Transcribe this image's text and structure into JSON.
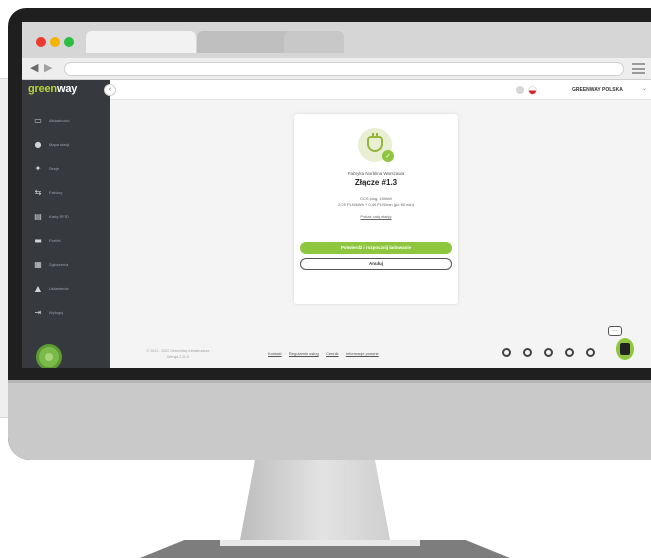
{
  "app": {
    "logo_green": "green",
    "logo_white": "way"
  },
  "browser": {
    "back_icon": "triangle-left-icon",
    "forward_icon": "triangle-right-icon"
  },
  "header": {
    "account_name": "GREENWAY POLSKA",
    "account_caret": "⌄"
  },
  "sidebar": {
    "items": [
      {
        "icon": "chat-icon",
        "glyph": "▭",
        "label": "Aktualności"
      },
      {
        "icon": "map-pin-icon",
        "glyph": "●",
        "label": "Mapa stacji"
      },
      {
        "icon": "lightning-icon",
        "glyph": "✦",
        "label": "Sesje"
      },
      {
        "icon": "arrows-icon",
        "glyph": "⇆",
        "label": "Faktury"
      },
      {
        "icon": "card-icon",
        "glyph": "▤",
        "label": "Karty RFID"
      },
      {
        "icon": "wallet-icon",
        "glyph": "▬",
        "label": "Portfel"
      },
      {
        "icon": "envelope-icon",
        "glyph": "▦",
        "label": "Zgłoszenia"
      },
      {
        "icon": "user-icon",
        "glyph": "▲",
        "label": "Ustawienia"
      },
      {
        "icon": "logout-icon",
        "glyph": "⇥",
        "label": "Wyloguj"
      }
    ]
  },
  "connector_card": {
    "location": "Fabryka Norblina Warszawa",
    "connector": "Złącze #1.3",
    "specs": "CCS plug, 150kW",
    "price": "2,29 PLN/kWh + 0,40 PLN/min (po 60 min)",
    "details_link": "Pokaż całą stację",
    "primary_button": "Potwierdź i rozpocznij ładowanie",
    "secondary_button": "Anuluj"
  },
  "footer": {
    "copyright_line1": "© 2021 - 2022 GreenWay Infrastructure",
    "copyright_line2": "Wersja 2.11.0",
    "links": [
      "Kontakt",
      "Regulamin usług",
      "Cennik",
      "Informacje prawne"
    ],
    "separator": "·",
    "social_icons": [
      "facebook-icon",
      "instagram-icon",
      "linkedin-icon",
      "twitter-icon",
      "youtube-icon"
    ]
  },
  "chat": {
    "bubble_text": "…"
  }
}
